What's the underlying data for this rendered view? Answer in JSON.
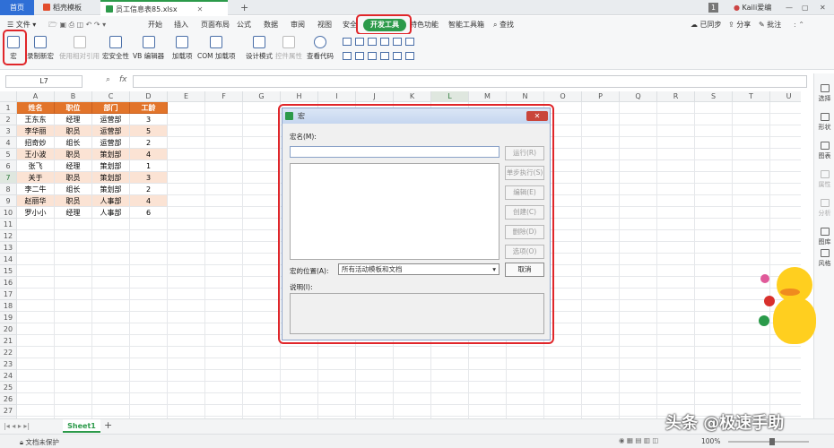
{
  "tabs": {
    "home": "首页",
    "template": "稻壳模板",
    "file": "员工信息表85.xlsx",
    "add": "+"
  },
  "titlebar": {
    "badge": "1",
    "user": "Kaili爱编"
  },
  "menu": {
    "file": "文件",
    "items": [
      "开始",
      "插入",
      "页面布局",
      "公式",
      "数据",
      "审阅",
      "视图",
      "安全"
    ],
    "devtools": "开发工具",
    "extra": [
      "特色功能",
      "智能工具箱"
    ],
    "search": "查找",
    "right": [
      "已同步",
      "分享",
      "批注"
    ]
  },
  "ribbon": {
    "buttons": [
      {
        "label": "宏",
        "disabled": false
      },
      {
        "label": "录制新宏",
        "disabled": false
      },
      {
        "label": "使用相对引用",
        "disabled": true
      },
      {
        "label": "宏安全性",
        "disabled": false
      },
      {
        "label": "VB 编辑器",
        "disabled": false
      },
      {
        "label": "加载项",
        "disabled": false
      },
      {
        "label": "COM 加载项",
        "disabled": false
      },
      {
        "label": "设计模式",
        "disabled": false
      },
      {
        "label": "控件属性",
        "disabled": true
      },
      {
        "label": "查看代码",
        "disabled": false
      }
    ]
  },
  "formula": {
    "cell_ref": "L7",
    "fx": "fx"
  },
  "grid": {
    "columns": [
      "A",
      "B",
      "C",
      "D",
      "E",
      "F",
      "G",
      "H",
      "I",
      "J",
      "K",
      "L",
      "M",
      "N",
      "O",
      "P",
      "Q",
      "R",
      "S",
      "T",
      "U"
    ],
    "rows": [
      "1",
      "2",
      "3",
      "4",
      "5",
      "6",
      "7",
      "8",
      "9",
      "10",
      "11",
      "12",
      "13",
      "14",
      "15",
      "16",
      "17",
      "18",
      "19",
      "20",
      "21",
      "22",
      "23",
      "24",
      "25",
      "26",
      "27",
      "28"
    ],
    "header": [
      "姓名",
      "职位",
      "部门",
      "工龄"
    ],
    "data": [
      [
        "王东东",
        "经理",
        "运营部",
        "3"
      ],
      [
        "李华丽",
        "职员",
        "运营部",
        "5"
      ],
      [
        "招奇妙",
        "组长",
        "运营部",
        "2"
      ],
      [
        "王小波",
        "职员",
        "策划部",
        "4"
      ],
      [
        "张飞",
        "经理",
        "策划部",
        "1"
      ],
      [
        "关于",
        "职员",
        "策划部",
        "3"
      ],
      [
        "李二牛",
        "组长",
        "策划部",
        "2"
      ],
      [
        "赵丽华",
        "职员",
        "人事部",
        "4"
      ],
      [
        "罗小小",
        "经理",
        "人事部",
        "6"
      ]
    ]
  },
  "sidebar": [
    "选择",
    "形状",
    "图表",
    "属性",
    "分析",
    "图库",
    "风格"
  ],
  "sheets": {
    "active": "Sheet1",
    "add": "+"
  },
  "status": {
    "protect": "文档未保护",
    "zoom": "100%"
  },
  "dialog": {
    "title": "宏",
    "macro_name_label": "宏名(M):",
    "macro_name_value": "",
    "buttons": [
      {
        "label": "运行(R)",
        "enabled": false
      },
      {
        "label": "单步执行(S)",
        "enabled": false
      },
      {
        "label": "编辑(E)",
        "enabled": false
      },
      {
        "label": "创建(C)",
        "enabled": false
      },
      {
        "label": "删除(D)",
        "enabled": false
      },
      {
        "label": "选项(O)",
        "enabled": false
      }
    ],
    "location_label": "宏的位置(A):",
    "location_value": "所有活动模板和文档",
    "cancel": "取消",
    "desc_label": "说明(I):",
    "close": "✕"
  },
  "watermark": "头条 @极速手助",
  "colors": {
    "accent_green": "#2c9a4a",
    "highlight_red": "#e0262a",
    "header_orange": "#e2742a",
    "row_orange": "#fbe3d4"
  }
}
